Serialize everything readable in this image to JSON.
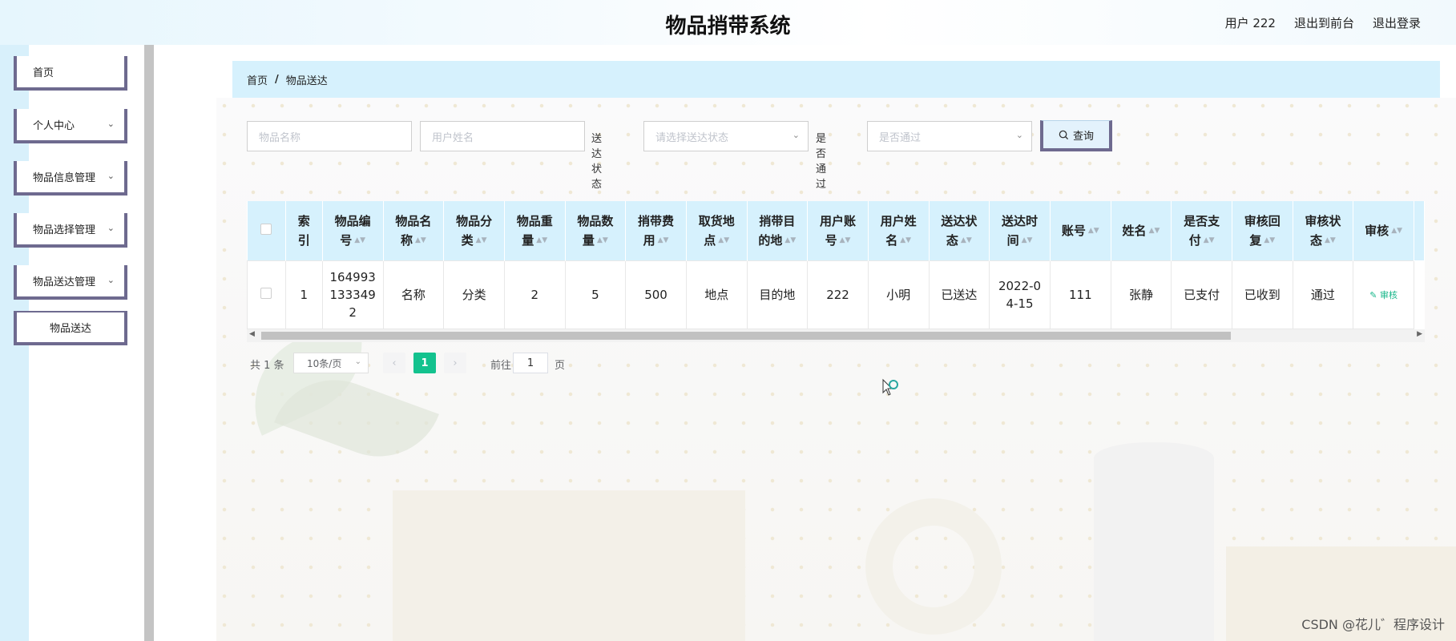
{
  "header": {
    "title": "物品捎带系统",
    "links": [
      "用户 222",
      "退出到前台",
      "退出登录"
    ]
  },
  "sidebar": {
    "items": [
      {
        "label": "首页",
        "has_arrow": false
      },
      {
        "label": "个人中心",
        "has_arrow": true
      },
      {
        "label": "物品信息管理",
        "has_arrow": true
      },
      {
        "label": "物品选择管理",
        "has_arrow": true
      },
      {
        "label": "物品送达管理",
        "has_arrow": true
      }
    ],
    "sub_item": "物品送达"
  },
  "breadcrumb": {
    "home": "首页",
    "separator": "/",
    "current": "物品送达"
  },
  "search": {
    "item_name_placeholder": "物品名称",
    "user_name_placeholder": "用户姓名",
    "status_label": "送达状态",
    "status_placeholder": "请选择送达状态",
    "pass_label": "是否通过",
    "pass_placeholder": "是否通过",
    "query_label": "查询"
  },
  "table": {
    "headers": [
      {
        "key": "index",
        "lines": [
          "索",
          "引"
        ],
        "sortable": false
      },
      {
        "key": "item_no",
        "lines": [
          "物品编",
          "号"
        ],
        "sortable": true
      },
      {
        "key": "item_name",
        "lines": [
          "物品名",
          "称"
        ],
        "sortable": true
      },
      {
        "key": "category",
        "lines": [
          "物品分",
          "类"
        ],
        "sortable": true
      },
      {
        "key": "weight",
        "lines": [
          "物品重",
          "量"
        ],
        "sortable": true
      },
      {
        "key": "quantity",
        "lines": [
          "物品数",
          "量"
        ],
        "sortable": true
      },
      {
        "key": "fee",
        "lines": [
          "捎带费",
          "用"
        ],
        "sortable": true
      },
      {
        "key": "pickup",
        "lines": [
          "取货地",
          "点"
        ],
        "sortable": true
      },
      {
        "key": "destination",
        "lines": [
          "捎带目",
          "的地"
        ],
        "sortable": true
      },
      {
        "key": "user_account",
        "lines": [
          "用户账",
          "号"
        ],
        "sortable": true
      },
      {
        "key": "user_name",
        "lines": [
          "用户姓",
          "名"
        ],
        "sortable": true
      },
      {
        "key": "status",
        "lines": [
          "送达状",
          "态"
        ],
        "sortable": true
      },
      {
        "key": "time",
        "lines": [
          "送达时",
          "间"
        ],
        "sortable": true
      },
      {
        "key": "account",
        "lines": [
          "账号"
        ],
        "sortable": true
      },
      {
        "key": "name",
        "lines": [
          "姓名"
        ],
        "sortable": true
      },
      {
        "key": "paid",
        "lines": [
          "是否支",
          "付"
        ],
        "sortable": true
      },
      {
        "key": "reply",
        "lines": [
          "审核回",
          "复"
        ],
        "sortable": true
      },
      {
        "key": "audit_status",
        "lines": [
          "审核状",
          "态"
        ],
        "sortable": true
      },
      {
        "key": "audit",
        "lines": [
          "审核"
        ],
        "sortable": true
      }
    ],
    "rows": [
      {
        "index": "1",
        "item_no": [
          "164993",
          "133349",
          "2"
        ],
        "item_name": "名称",
        "category": "分类",
        "weight": "2",
        "quantity": "5",
        "fee": "500",
        "pickup": "地点",
        "destination": "目的地",
        "user_account": "222",
        "user_name": "小明",
        "status": "已送达",
        "time": [
          "2022-0",
          "4-15"
        ],
        "account": "111",
        "name": "张静",
        "paid": "已支付",
        "reply": "已收到",
        "audit_status": "通过",
        "audit": "审核"
      }
    ]
  },
  "pagination": {
    "total": "共 1 条",
    "page_size": "10条/页",
    "current_page": "1",
    "goto_label": "前往",
    "goto_value": "1",
    "page_unit": "页"
  },
  "watermark": "CSDN @花儿゛程序设计"
}
